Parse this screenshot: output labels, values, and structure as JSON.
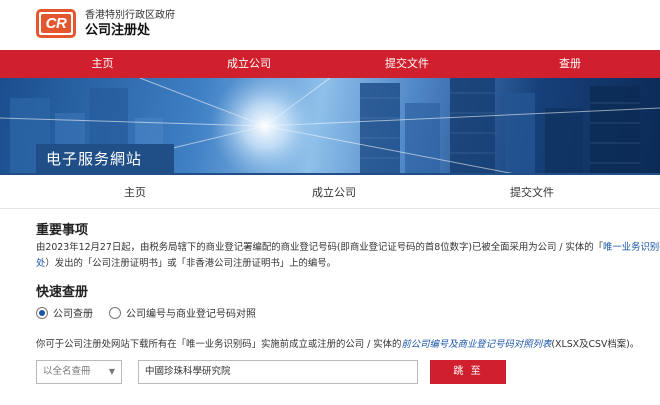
{
  "header": {
    "logo_text": "CR",
    "org_line1": "香港特別行政区政府",
    "org_line2": "公司注册处"
  },
  "nav": {
    "items": [
      {
        "label": "主页"
      },
      {
        "label": "成立公司"
      },
      {
        "label": "提交文件"
      },
      {
        "label": "查册"
      }
    ]
  },
  "banner": {
    "title": "电子服务網站"
  },
  "subnav": {
    "items": [
      {
        "label": "主页"
      },
      {
        "label": "成立公司"
      },
      {
        "label": "提交文件"
      }
    ]
  },
  "notice": {
    "heading": "重要事项",
    "line1_text": "由2023年12月27日起，由税务局辖下的商业登记署编配的商业登记号码(即商业登记证号码的首8位数字)已被全面采用为公司 / 实体的「",
    "line1_link": "唯一业务识别码",
    "line2_link": "处",
    "line2_text": "）发出的「公司注册证明书」或「非香港公司注册证明书」上的编号。"
  },
  "quick": {
    "heading": "快速查册",
    "options": [
      {
        "label": "公司查册",
        "selected": true
      },
      {
        "label": "公司编号与商业登记号码对照",
        "selected": false
      }
    ],
    "download_prefix": "你可于公司注册处网站下载所有在「唯一业务识别码」实施前成立或注册的公司 / 实体的",
    "download_link": "前公司编号及商业登记号码对照列表",
    "download_suffix": "(XLSX及CSV档案)。"
  },
  "search": {
    "select_value": "以全名查冊",
    "input_value": "中國珍珠科學研究院",
    "button_label": "跳 至"
  },
  "colors": {
    "brand_red": "#d0202e",
    "logo_orange": "#e4572e",
    "banner_blue": "#1f4f86",
    "link_blue": "#1a55a8"
  }
}
